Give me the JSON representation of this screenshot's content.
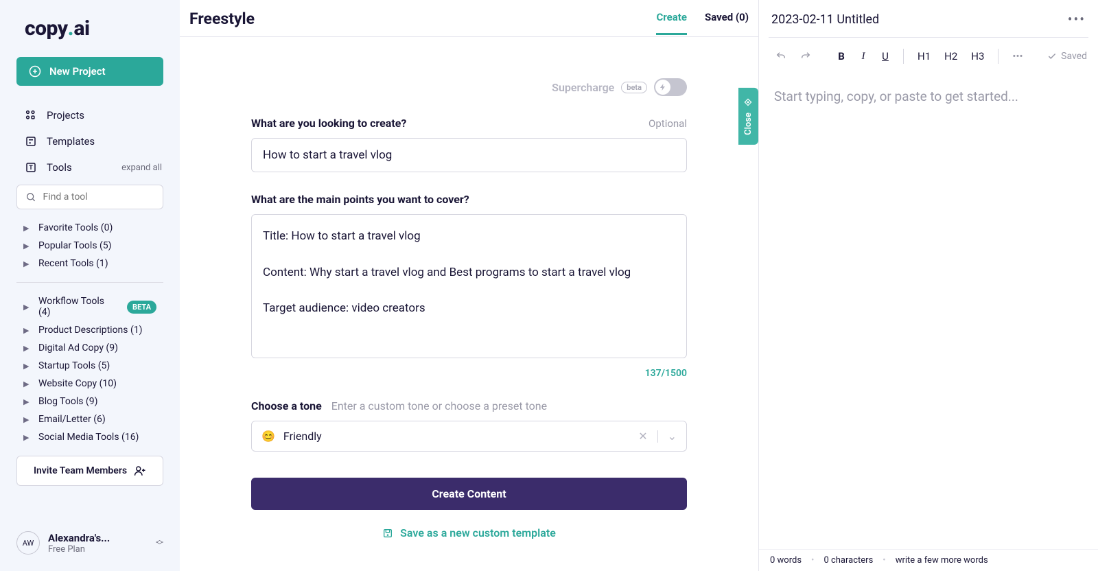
{
  "logo": {
    "text": "copy",
    "accentDot": ".",
    "suffix": "ai"
  },
  "sidebar": {
    "newProject": "New Project",
    "nav": {
      "projects": "Projects",
      "templates": "Templates",
      "tools": "Tools",
      "expandAll": "expand all"
    },
    "searchPlaceholder": "Find a tool",
    "quickTools": [
      "Favorite Tools (0)",
      "Popular Tools (5)",
      "Recent Tools (1)"
    ],
    "categories": [
      {
        "label": "Workflow Tools (4)",
        "beta": true
      },
      {
        "label": "Product Descriptions (1)"
      },
      {
        "label": "Digital Ad Copy (9)"
      },
      {
        "label": "Startup Tools (5)"
      },
      {
        "label": "Website Copy (10)"
      },
      {
        "label": "Blog Tools (9)"
      },
      {
        "label": "Email/Letter (6)"
      },
      {
        "label": "Social Media Tools (16)"
      }
    ],
    "invite": "Invite Team Members",
    "user": {
      "initials": "AW",
      "name": "Alexandra's...",
      "plan": "Free Plan"
    }
  },
  "main": {
    "title": "Freestyle",
    "tabs": {
      "create": "Create",
      "saved": "Saved (0)"
    },
    "supercharge": {
      "label": "Supercharge",
      "beta": "beta"
    },
    "q1": {
      "label": "What are you looking to create?",
      "optional": "Optional",
      "value": "How to start a travel vlog"
    },
    "q2": {
      "label": "What are the main points you want to cover?",
      "value": "Title: How to start a travel vlog\n\nContent: Why start a travel vlog and Best programs to start a travel vlog\n\nTarget audience: video creators"
    },
    "charCount": "137/1500",
    "tone": {
      "label": "Choose a tone",
      "hint": "Enter a custom tone or choose a preset tone",
      "emoji": "😊",
      "value": "Friendly"
    },
    "createBtn": "Create Content",
    "saveTemplate": "Save as a new custom template",
    "closeTab": "Close"
  },
  "editor": {
    "title": "2023-02-11 Untitled",
    "toolbar": {
      "b": "B",
      "i": "I",
      "u": "U",
      "h1": "H1",
      "h2": "H2",
      "h3": "H3",
      "saved": "Saved"
    },
    "placeholder": "Start typing, copy, or paste to get started...",
    "footer": {
      "words": "0 words",
      "chars": "0 characters",
      "hint": "write a few more words"
    }
  }
}
